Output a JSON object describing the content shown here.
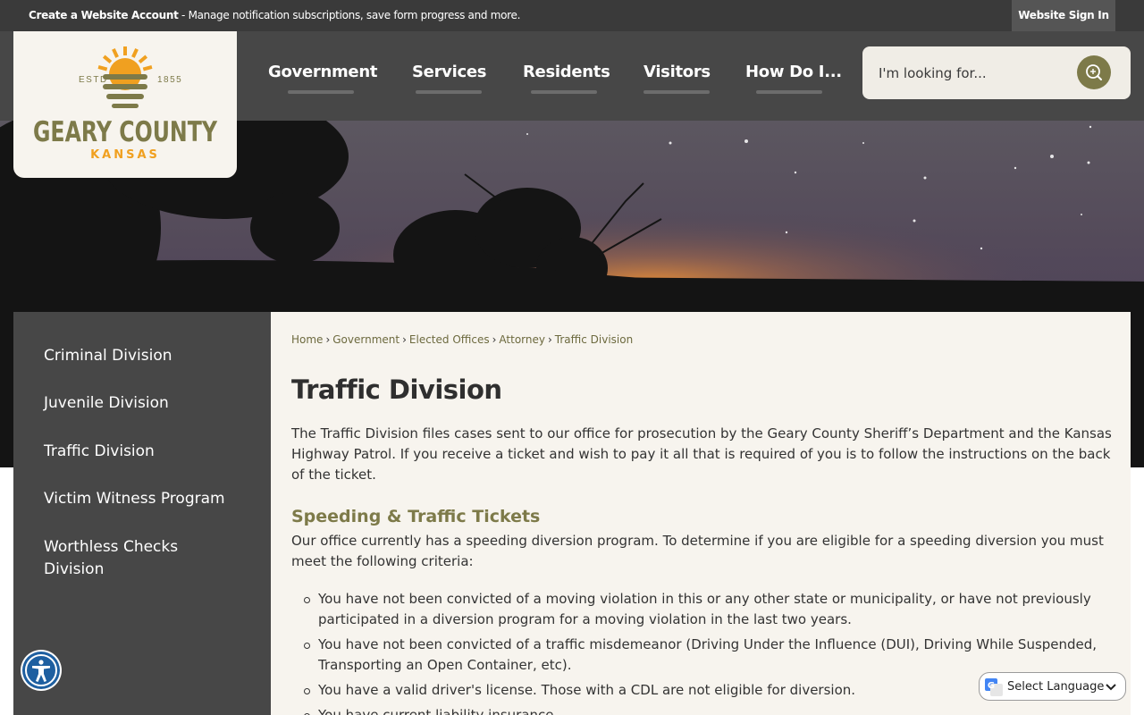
{
  "topbar": {
    "create_account": "Create a Website Account",
    "message": " - Manage notification subscriptions, save form progress and more.",
    "sign_in": "Website Sign In"
  },
  "logo": {
    "estd": "ESTD",
    "year": "1855",
    "name": "GEARY COUNTY",
    "state": "KANSAS"
  },
  "nav": {
    "items": [
      {
        "label": "Government"
      },
      {
        "label": "Services"
      },
      {
        "label": "Residents"
      },
      {
        "label": "Visitors"
      },
      {
        "label": "How Do I..."
      }
    ]
  },
  "search": {
    "placeholder": "I'm looking for..."
  },
  "sidebar": {
    "items": [
      {
        "label": "Criminal Division"
      },
      {
        "label": "Juvenile Division"
      },
      {
        "label": "Traffic Division"
      },
      {
        "label": "Victim Witness Program"
      },
      {
        "label": "Worthless Checks Division"
      }
    ]
  },
  "breadcrumb": {
    "items": [
      "Home",
      "Government",
      "Elected Offices",
      "Attorney",
      "Traffic Division"
    ],
    "separator": "›"
  },
  "content": {
    "title": "Traffic Division",
    "intro": "The Traffic Division files cases sent to our office for prosecution by the Geary County Sheriff’s Department and the Kansas Highway Patrol. If you receive a ticket and wish to pay it all that is required of you is to follow the instructions on the back of the ticket.",
    "subheading": "Speeding & Traffic Tickets",
    "criteria_intro": "Our office currently has a speeding diversion program. To determine if you are eligible for a speeding diversion you must meet the following criteria:",
    "criteria": [
      "You have not been convicted of a moving violation in this or any other state or municipality, or have not previously participated in a diversion program for a moving violation in the last two years.",
      "You have not been convicted of a traffic misdemeanor (Driving Under the Influence (DUI), Driving While Suspended, Transporting an Open Container, etc).",
      "You have a valid driver's license. Those with a CDL are not eligible for diversion.",
      "You have current liability insurance."
    ]
  },
  "widgets": {
    "translate_label": "Select Language",
    "accessibility_icon": "accessibility-icon"
  },
  "colors": {
    "olive": "#7d7a49",
    "dark_gray": "#474747",
    "cream": "#f7f4ee",
    "sun_orange": "#f0a020"
  }
}
